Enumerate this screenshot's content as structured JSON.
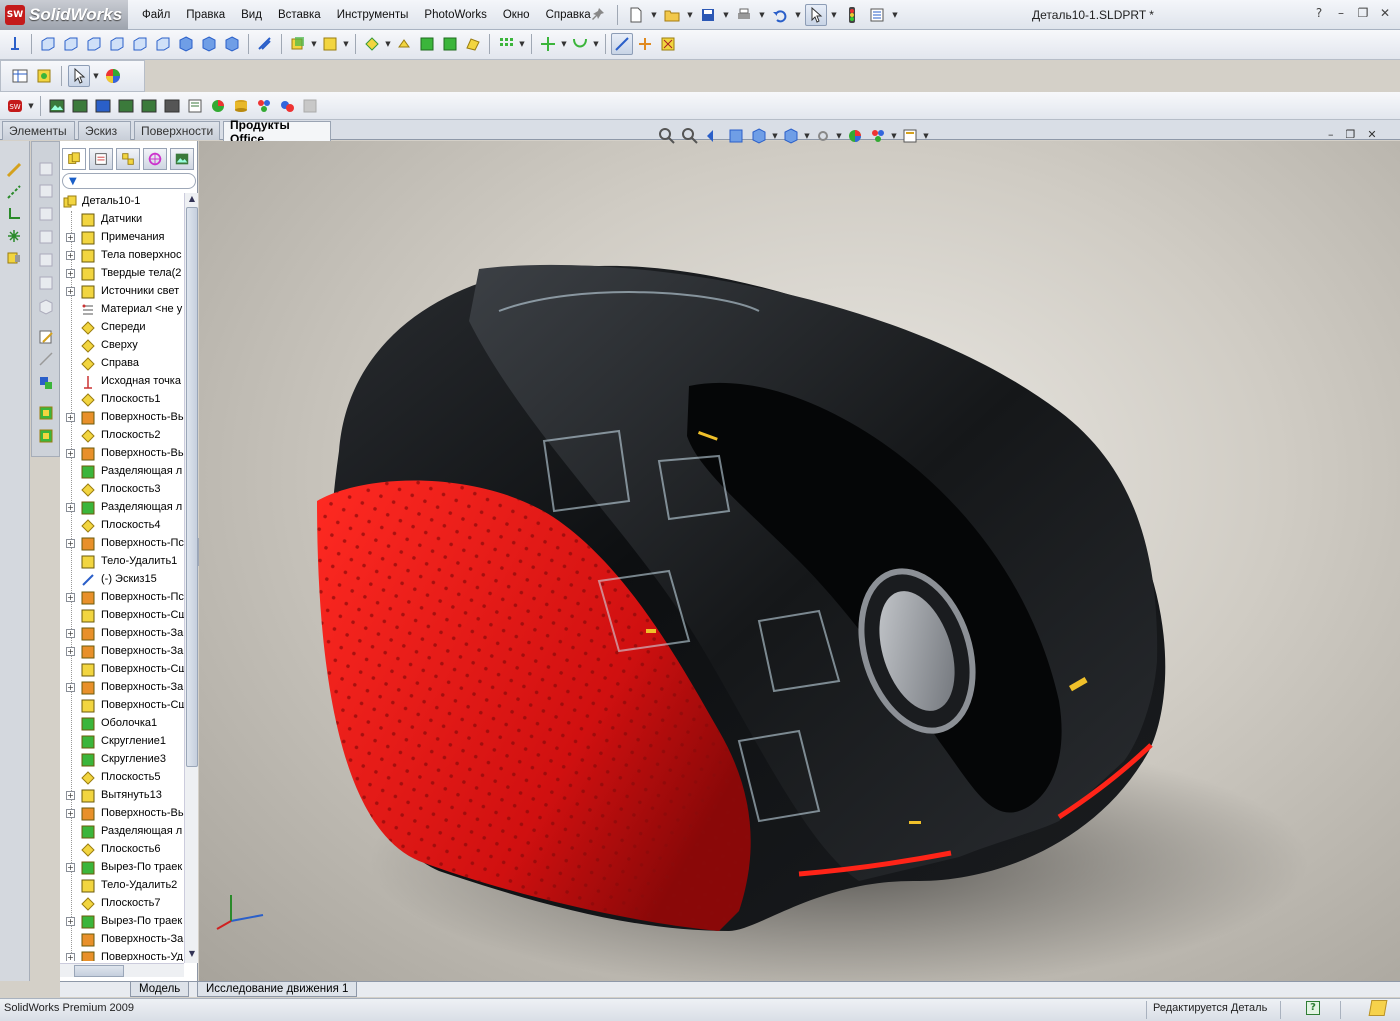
{
  "app": {
    "brand": "SolidWorks",
    "logo_mark": "SW",
    "document_title": "Деталь10-1.SLDPRT *"
  },
  "menu": [
    "Файл",
    "Правка",
    "Вид",
    "Вставка",
    "Инструменты",
    "PhotoWorks",
    "Окно",
    "Справка"
  ],
  "window_controls": [
    "?",
    "–",
    "❐",
    "✕"
  ],
  "command_tabs": [
    {
      "label": "Элементы",
      "active": false
    },
    {
      "label": "Эскиз",
      "active": false
    },
    {
      "label": "Поверхности",
      "active": false
    },
    {
      "label": "Продукты Office",
      "active": true
    }
  ],
  "feature_tree": {
    "filter_icon": "funnel-icon",
    "root": "Деталь10-1",
    "items": [
      {
        "label": "Датчики",
        "icon": "sensor-icon",
        "expandable": false
      },
      {
        "label": "Примечания",
        "icon": "annotation-icon",
        "expandable": true
      },
      {
        "label": "Тела поверхнос",
        "icon": "surface-body-icon",
        "expandable": true
      },
      {
        "label": "Твердые тела(2",
        "icon": "solid-body-icon",
        "expandable": true
      },
      {
        "label": "Источники свет",
        "icon": "light-icon",
        "expandable": true
      },
      {
        "label": "Материал <не у",
        "icon": "material-icon",
        "expandable": false
      },
      {
        "label": "Спереди",
        "icon": "plane-icon",
        "expandable": false
      },
      {
        "label": "Сверху",
        "icon": "plane-icon",
        "expandable": false
      },
      {
        "label": "Справа",
        "icon": "plane-icon",
        "expandable": false
      },
      {
        "label": "Исходная точка",
        "icon": "origin-icon",
        "expandable": false
      },
      {
        "label": "Плоскость1",
        "icon": "plane-icon",
        "expandable": false
      },
      {
        "label": "Поверхность-Вь",
        "icon": "surface-extrude-icon",
        "expandable": true
      },
      {
        "label": "Плоскость2",
        "icon": "plane-icon",
        "expandable": false
      },
      {
        "label": "Поверхность-Вь",
        "icon": "surface-extrude-icon",
        "expandable": true
      },
      {
        "label": "Разделяющая л",
        "icon": "split-line-icon",
        "expandable": false
      },
      {
        "label": "Плоскость3",
        "icon": "plane-icon",
        "expandable": false
      },
      {
        "label": "Разделяющая л",
        "icon": "split-line-icon",
        "expandable": true
      },
      {
        "label": "Плоскость4",
        "icon": "plane-icon",
        "expandable": false
      },
      {
        "label": "Поверхность-Пс",
        "icon": "surface-loft-icon",
        "expandable": true
      },
      {
        "label": "Тело-Удалить1",
        "icon": "delete-body-icon",
        "expandable": false
      },
      {
        "label": "(-) Эскиз15",
        "icon": "sketch-icon",
        "expandable": false
      },
      {
        "label": "Поверхность-Пс",
        "icon": "surface-loft-icon",
        "expandable": true
      },
      {
        "label": "Поверхность-Сш",
        "icon": "surface-knit-icon",
        "expandable": false
      },
      {
        "label": "Поверхность-За",
        "icon": "surface-fill-icon",
        "expandable": true
      },
      {
        "label": "Поверхность-За",
        "icon": "surface-fill-icon",
        "expandable": true
      },
      {
        "label": "Поверхность-Сш",
        "icon": "surface-knit-icon",
        "expandable": false
      },
      {
        "label": "Поверхность-За",
        "icon": "surface-fill-icon",
        "expandable": true
      },
      {
        "label": "Поверхность-Сш",
        "icon": "surface-knit-icon",
        "expandable": false
      },
      {
        "label": "Оболочка1",
        "icon": "shell-icon",
        "expandable": false
      },
      {
        "label": "Скругление1",
        "icon": "fillet-icon",
        "expandable": false
      },
      {
        "label": "Скругление3",
        "icon": "fillet-icon",
        "expandable": false
      },
      {
        "label": "Плоскость5",
        "icon": "plane-icon",
        "expandable": false
      },
      {
        "label": "Вытянуть13",
        "icon": "extrude-icon",
        "expandable": true
      },
      {
        "label": "Поверхность-Вь",
        "icon": "surface-extrude-icon",
        "expandable": true
      },
      {
        "label": "Разделяющая л",
        "icon": "split-line-icon",
        "expandable": false
      },
      {
        "label": "Плоскость6",
        "icon": "plane-icon",
        "expandable": false
      },
      {
        "label": "Вырез-По траек",
        "icon": "sweep-cut-icon",
        "expandable": true
      },
      {
        "label": "Тело-Удалить2",
        "icon": "delete-body-icon",
        "expandable": false
      },
      {
        "label": "Плоскость7",
        "icon": "plane-icon",
        "expandable": false
      },
      {
        "label": "Вырез-По траек",
        "icon": "sweep-cut-icon",
        "expandable": true
      },
      {
        "label": "Поверхность-За",
        "icon": "surface-fill-icon",
        "expandable": false
      },
      {
        "label": "Поверхность-Уд",
        "icon": "surface-delete-icon",
        "expandable": true
      }
    ]
  },
  "bottom_tabs": [
    {
      "label": "Модель",
      "active": true
    },
    {
      "label": "Исследование движения 1",
      "active": false
    }
  ],
  "status": {
    "product": "SolidWorks Premium 2009",
    "mode": "Редактируется Деталь",
    "help": "?"
  },
  "colors": {
    "mouse_red": "#e01818",
    "mouse_black": "#101214",
    "accent": "#3a6fd6"
  }
}
